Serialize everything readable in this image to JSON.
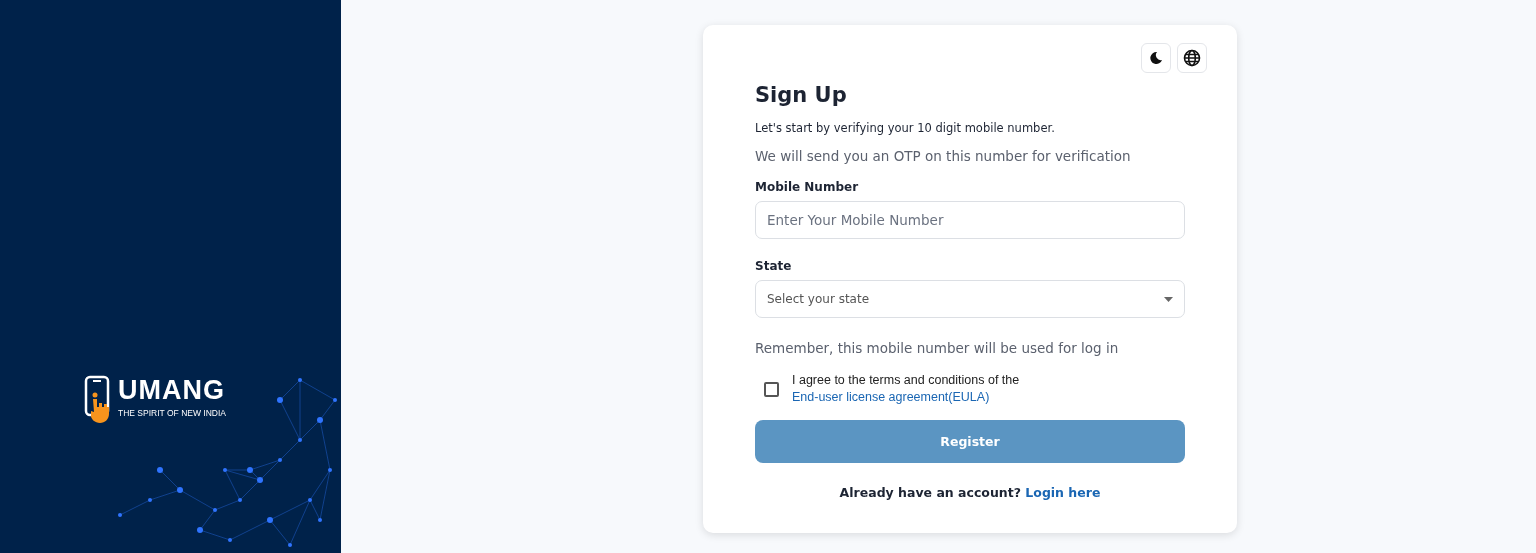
{
  "brand": {
    "name": "UMANG",
    "tagline": "THE SPIRIT OF NEW INDIA"
  },
  "form": {
    "title": "Sign Up",
    "subtitle": "Let's start by verifying your 10 digit mobile number.",
    "note": "We will send you an OTP on this number for verification",
    "mobile": {
      "label": "Mobile Number",
      "placeholder": "Enter Your Mobile Number"
    },
    "state": {
      "label": "State",
      "placeholder": "Select your state"
    },
    "remember": "Remember, this mobile number will be used for log in",
    "agree": {
      "checked": false,
      "text": "I agree to the terms and conditions of the",
      "link": "End-user license agreement(EULA)"
    },
    "register": {
      "label": "Register",
      "disabled": true
    },
    "footer": {
      "text": "Already have an account?",
      "link": "Login here"
    }
  }
}
